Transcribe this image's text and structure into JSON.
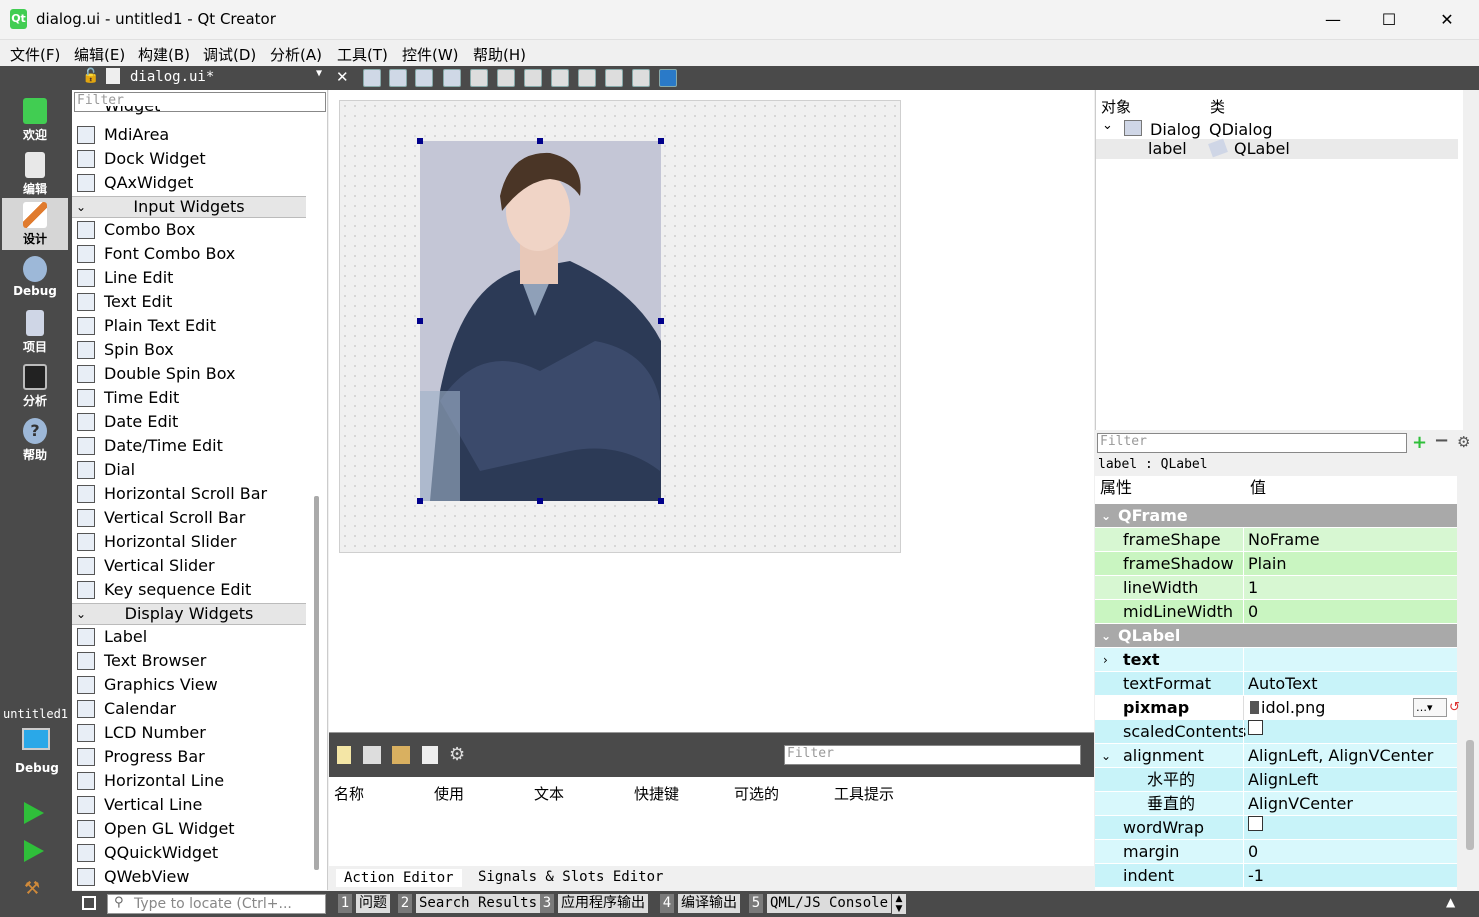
{
  "window": {
    "title": "dialog.ui - untitled1 - Qt Creator",
    "app_icon": "Qt",
    "minimize": "—",
    "maximize": "☐",
    "close": "✕"
  },
  "menu": [
    "文件(F)",
    "编辑(E)",
    "构建(B)",
    "调试(D)",
    "分析(A)",
    "工具(T)",
    "控件(W)",
    "帮助(H)"
  ],
  "modes": [
    {
      "label": "欢迎",
      "icon": "qt-logo-icon"
    },
    {
      "label": "编辑",
      "icon": "edit-icon"
    },
    {
      "label": "设计",
      "icon": "design-icon"
    },
    {
      "label": "Debug",
      "icon": "debug-icon"
    },
    {
      "label": "项目",
      "icon": "project-icon"
    },
    {
      "label": "分析",
      "icon": "analyze-icon"
    },
    {
      "label": "帮助",
      "icon": "help-icon"
    }
  ],
  "kit": {
    "project": "untitled1",
    "config": "Debug"
  },
  "document": {
    "tab": "dialog.ui*"
  },
  "widgetbox": {
    "filter_placeholder": "Filter",
    "partial_top": "Widget",
    "containers_tail": [
      "MdiArea",
      "Dock Widget",
      "QAxWidget"
    ],
    "input_category": "Input Widgets",
    "input_widgets": [
      "Combo Box",
      "Font Combo Box",
      "Line Edit",
      "Text Edit",
      "Plain Text Edit",
      "Spin Box",
      "Double Spin Box",
      "Time Edit",
      "Date Edit",
      "Date/Time Edit",
      "Dial",
      "Horizontal Scroll Bar",
      "Vertical Scroll Bar",
      "Horizontal Slider",
      "Vertical Slider",
      "Key sequence Edit"
    ],
    "display_category": "Display Widgets",
    "display_widgets": [
      "Label",
      "Text Browser",
      "Graphics View",
      "Calendar",
      "LCD Number",
      "Progress Bar",
      "Horizontal Line",
      "Vertical Line",
      "Open GL Widget",
      "QQuickWidget",
      "QWebView"
    ]
  },
  "action_editor": {
    "filter_placeholder": "Filter",
    "columns": [
      "名称",
      "使用",
      "文本",
      "快捷键",
      "可选的",
      "工具提示"
    ],
    "tabs": [
      "Action Editor",
      "Signals & Slots Editor"
    ]
  },
  "object_inspector": {
    "columns": [
      "对象",
      "类"
    ],
    "rows": [
      {
        "object": "Dialog",
        "class": "QDialog"
      },
      {
        "object": "label",
        "class": "QLabel"
      }
    ]
  },
  "property_editor": {
    "filter_placeholder": "Filter",
    "object": "label : QLabel",
    "columns": [
      "属性",
      "值"
    ],
    "groups": {
      "qframe": "QFrame",
      "qlabel": "QLabel"
    },
    "rows": {
      "frameShape": "NoFrame",
      "frameShadow": "Plain",
      "lineWidth": "1",
      "midLineWidth": "0",
      "text": "",
      "textFormat": "AutoText",
      "pixmap": "idol.png",
      "alignment": "AlignLeft, AlignVCenter",
      "horizontal": "AlignLeft",
      "vertical": "AlignVCenter",
      "margin": "0",
      "indent": "-1"
    },
    "names": {
      "frameShape": "frameShape",
      "frameShadow": "frameShadow",
      "lineWidth": "lineWidth",
      "midLineWidth": "midLineWidth",
      "text": "text",
      "textFormat": "textFormat",
      "pixmap": "pixmap",
      "scaledContents": "scaledContents",
      "alignment": "alignment",
      "horizontal": "水平的",
      "vertical": "垂直的",
      "wordWrap": "wordWrap",
      "margin": "margin",
      "indent": "indent"
    }
  },
  "statusbar": {
    "locate_placeholder": "Type to locate (Ctrl+...",
    "tabs": [
      {
        "num": "1",
        "label": "问题"
      },
      {
        "num": "2",
        "label": "Search Results"
      },
      {
        "num": "3",
        "label": "应用程序输出"
      },
      {
        "num": "4",
        "label": "编译输出"
      },
      {
        "num": "5",
        "label": "QML/JS Console"
      }
    ]
  }
}
